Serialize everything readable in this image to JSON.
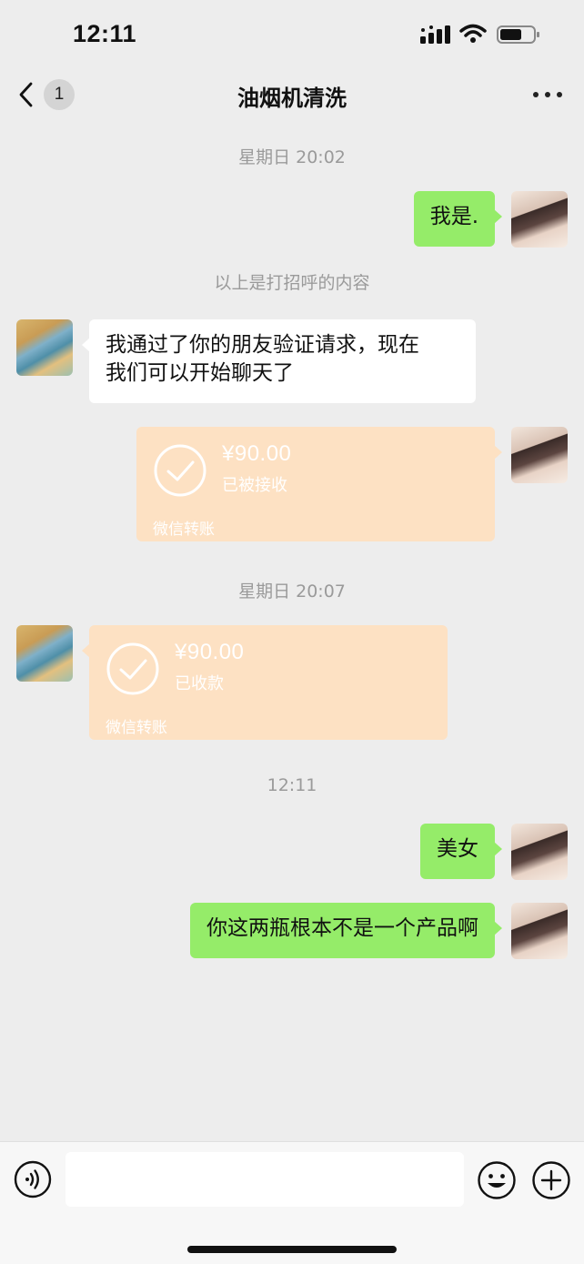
{
  "status_bar": {
    "time": "12:11"
  },
  "nav": {
    "unread_count": "1",
    "title": "油烟机清洗"
  },
  "chat": {
    "timestamp_1": "星期日 20:02",
    "msg_me_1": "我是.",
    "system_note": "以上是打招呼的内容",
    "msg_friend_1_line1": "我通过了你的朋友验证请求，现在",
    "msg_friend_1_line2": "我们可以开始聊天了",
    "transfer_1": {
      "amount": "¥90.00",
      "status": "已被接收",
      "label": "微信转账"
    },
    "timestamp_2": "星期日 20:07",
    "transfer_2": {
      "amount": "¥90.00",
      "status": "已收款",
      "label": "微信转账"
    },
    "timestamp_3": "12:11",
    "msg_me_2": "美女",
    "msg_me_3": "你这两瓶根本不是一个产品啊"
  },
  "input_bar": {
    "placeholder": ""
  },
  "colors": {
    "background": "#ededed",
    "my_bubble": "#95ec69",
    "friend_bubble": "#ffffff",
    "transfer_card": "#fde1c3"
  }
}
